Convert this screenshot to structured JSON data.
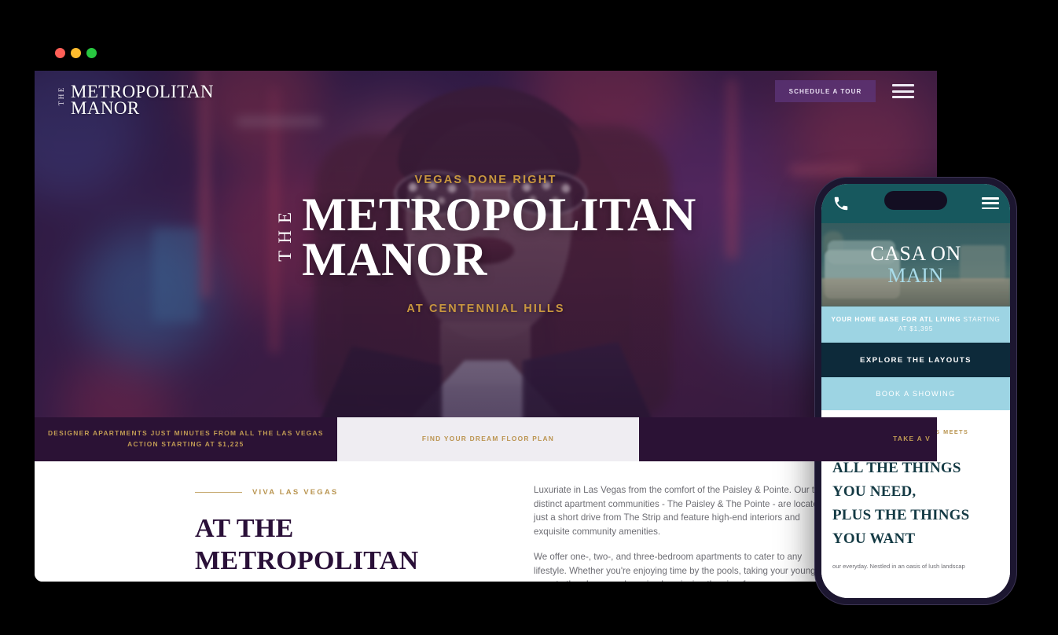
{
  "browser": {
    "traffic_lights": [
      {
        "name": "close",
        "color": "#ff5f57"
      },
      {
        "name": "minimize",
        "color": "#febc2e"
      },
      {
        "name": "zoom",
        "color": "#28c840"
      }
    ]
  },
  "desktop_site": {
    "logo": {
      "the": "THE",
      "name": "METROPOLITAN\nMANOR"
    },
    "nav": {
      "tour_button": "SCHEDULE A TOUR",
      "menu_icon": "hamburger-icon"
    },
    "hero": {
      "eyebrow": "VEGAS DONE RIGHT",
      "the": "THE",
      "title": "METROPOLITAN\nMANOR",
      "subtitle": "AT CENTENNIAL HILLS"
    },
    "cta_strip": [
      {
        "label": "DESIGNER APARTMENTS JUST MINUTES FROM ALL THE LAS VEGAS ACTION STARTING AT $1,225",
        "style": "dark"
      },
      {
        "label": "FIND YOUR DREAM FLOOR PLAN",
        "style": "light"
      },
      {
        "label": "TAKE A V",
        "style": "dark"
      }
    ],
    "section": {
      "kicker": "VIVA LAS VEGAS",
      "heading": "AT THE\nMETROPOLITAN",
      "paragraphs": [
        "Luxuriate in Las Vegas from the comfort of the Paisley & Pointe. Our two distinct apartment communities - The Paisley & The Pointe - are located just a short drive from The Strip and feature high-end interiors and exquisite community amenities.",
        "We offer one-, two-, and three-bedroom apartments to cater to any lifestyle. Whether you're enjoying time by the pools, taking your young ones to the playground, or simply enjoying the view from"
      ]
    }
  },
  "mobile_site": {
    "header": {
      "call_icon": "phone-icon",
      "menu_icon": "hamburger-icon"
    },
    "hero": {
      "title_line1": "CASA ON",
      "title_line2": "MAIN"
    },
    "band": {
      "bold": "YOUR HOME BASE FOR ATL LIVING",
      "thin": " STARTING AT $1,395"
    },
    "cta_primary": "EXPLORE THE LAYOUTS",
    "cta_secondary": "BOOK A SHOWING",
    "section": {
      "kicker": "WHERE LUXURIOUS MEETS LAIDBACK",
      "heading": "ALL THE THINGS\nYOU NEED,\nPLUS THE THINGS\nYOU WANT",
      "paragraph": "our everyday. Nestled in an oasis of lush landscap"
    }
  },
  "colors": {
    "hero_overlay": "#2b1235",
    "gold": "#c09b54",
    "deep_purple": "#2a1038",
    "teal": "#17585e",
    "light_blue": "#9dd4e3",
    "dark_navy": "#0d2a3a"
  }
}
